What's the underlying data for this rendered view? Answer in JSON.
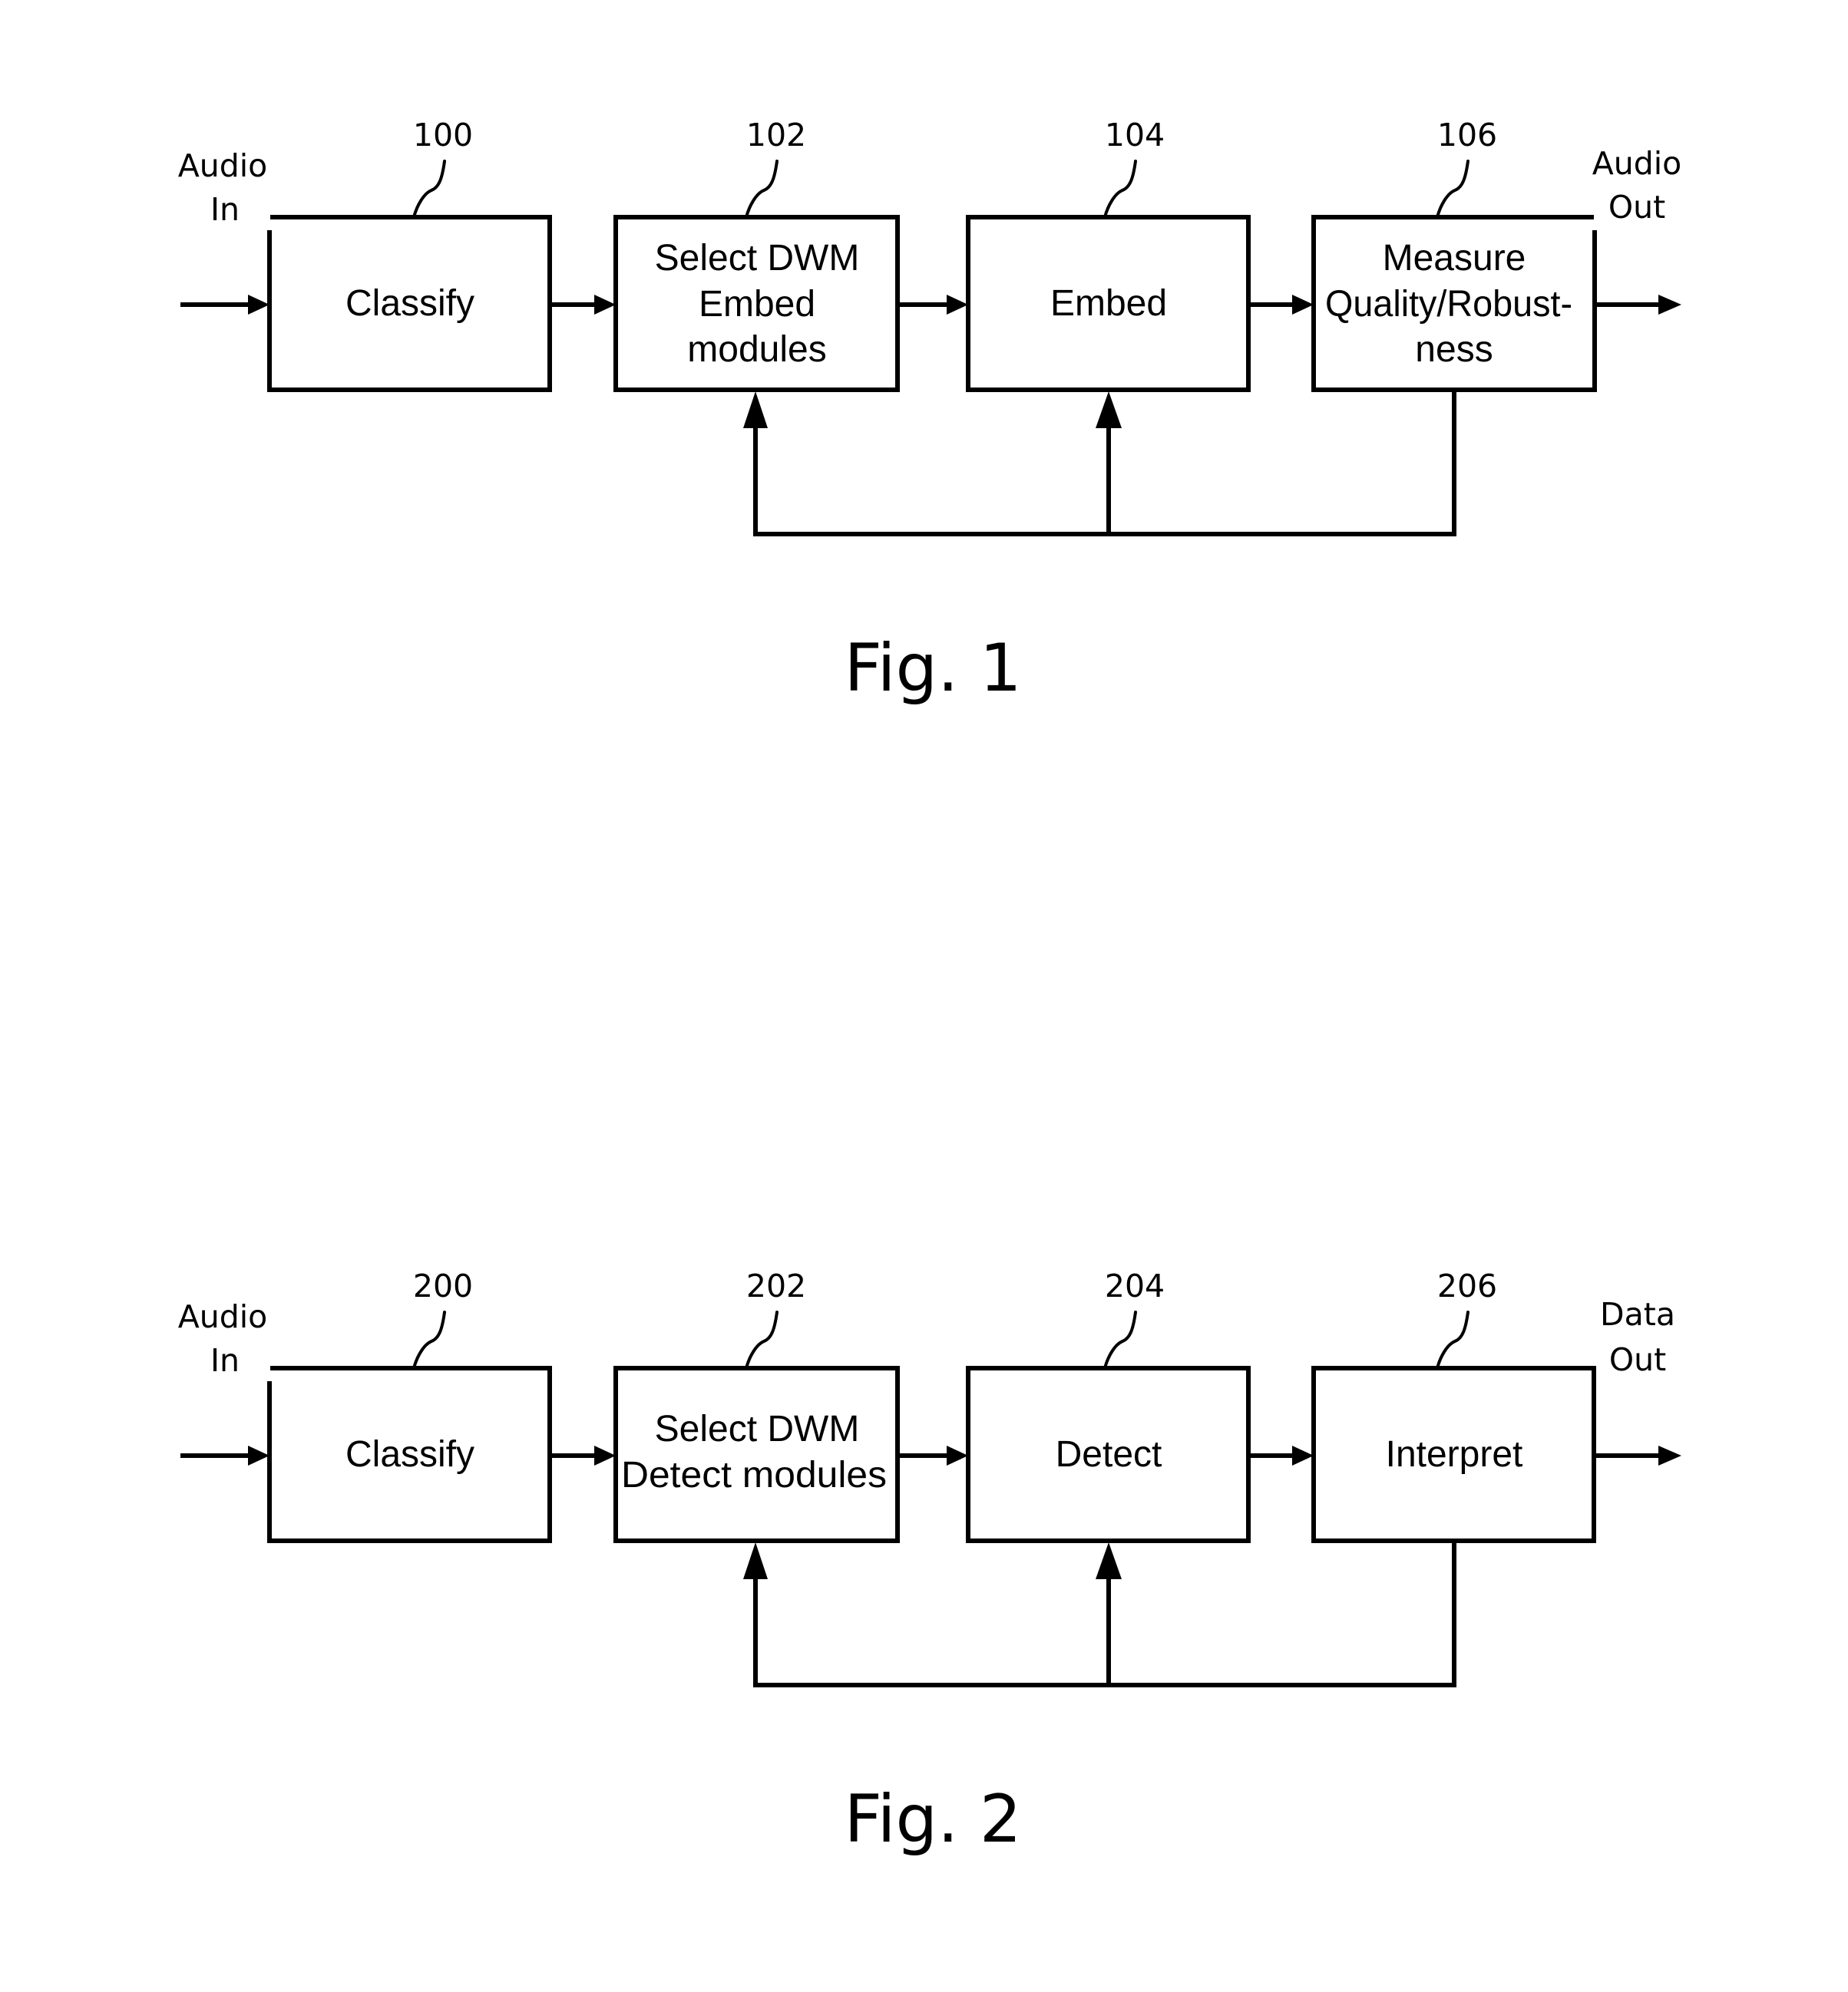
{
  "figures": [
    {
      "caption": "Fig. 1",
      "input_label": [
        "Audio",
        "In"
      ],
      "output_label": [
        "Audio",
        "Out"
      ],
      "blocks": [
        {
          "ref": "100",
          "lines": [
            "Classify"
          ]
        },
        {
          "ref": "102",
          "lines": [
            "Select DWM",
            "Embed",
            "modules"
          ]
        },
        {
          "ref": "104",
          "lines": [
            "Embed"
          ]
        },
        {
          "ref": "106",
          "lines": [
            "Measure",
            "Quality/Robust-",
            "ness"
          ]
        }
      ],
      "feedback": {
        "from": "106",
        "to": [
          "102",
          "104"
        ]
      }
    },
    {
      "caption": "Fig. 2",
      "input_label": [
        "Audio",
        "In"
      ],
      "output_label": [
        "Data",
        "Out"
      ],
      "blocks": [
        {
          "ref": "200",
          "lines": [
            "Classify"
          ]
        },
        {
          "ref": "202",
          "lines": [
            "Select DWM",
            "Detect modules"
          ]
        },
        {
          "ref": "204",
          "lines": [
            "Detect"
          ]
        },
        {
          "ref": "206",
          "lines": [
            "Interpret"
          ]
        }
      ],
      "feedback": {
        "from": "206",
        "to": [
          "202",
          "204"
        ]
      }
    }
  ],
  "colors": {
    "ink": "#000000",
    "background": "#ffffff"
  }
}
